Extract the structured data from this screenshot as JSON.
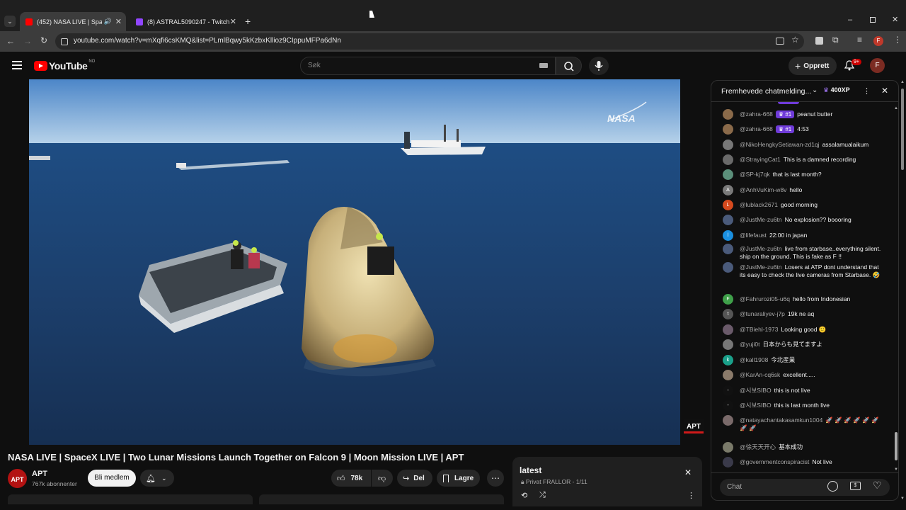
{
  "browser": {
    "tabs": [
      {
        "title": "(452) NASA LIVE | SpaceX LI",
        "active": true
      },
      {
        "title": "(8) ASTRAL5090247 - Twitch",
        "active": false
      }
    ],
    "url": "youtube.com/watch?v=mXqfi6csKMQ&list=PLmlBqwy5kKzbxKllioz9CIppuMFPa6dNn"
  },
  "youtube": {
    "logo_text": "YouTube",
    "region": "NO",
    "search_placeholder": "Søk",
    "create_label": "Opprett",
    "notif_count": "9+",
    "avatar_letter": "F"
  },
  "video": {
    "watermark": "NASA",
    "channel_bug": "APT"
  },
  "meta": {
    "title": "NASA LIVE | SpaceX LIVE | Two Lunar Missions Launch Together on Falcon 9 | Moon Mission LIVE | APT",
    "channel": "APT",
    "subscribers": "767k abonnenter",
    "join_label": "Bli medlem",
    "likes": "78k",
    "share_label": "Del",
    "save_label": "Lagre"
  },
  "playlist": {
    "title": "latest",
    "privacy": "Privat",
    "owner": "FRALLOR",
    "position": "1/11"
  },
  "chat": {
    "header": "Fremhevede chatmelding...",
    "xp_badge": "400XP",
    "input_placeholder": "Chat",
    "messages": [
      {
        "author": "@zahra-668",
        "badge": "#1",
        "text": "peanut butter",
        "avatar_color": "#8a6a4a",
        "initial": ""
      },
      {
        "author": "@zahra-668",
        "badge": "#1",
        "text": "4:53",
        "avatar_color": "#8a6a4a",
        "initial": ""
      },
      {
        "author": "@NikoHengkySetiawan-zd1qj",
        "badge": "",
        "text": "assalamualaikum",
        "avatar_color": "#777",
        "initial": ""
      },
      {
        "author": "@StrayingCat1",
        "badge": "",
        "text": "This is a damned recording",
        "avatar_color": "#6a6a6a",
        "initial": ""
      },
      {
        "author": "@SP-kj7qk",
        "badge": "",
        "text": "that is last month?",
        "avatar_color": "#5b8f7a",
        "initial": ""
      },
      {
        "author": "@AnhVuKim-w8v",
        "badge": "",
        "text": "hello",
        "avatar_color": "#7a7a7a",
        "initial": "A"
      },
      {
        "author": "@lublack2671",
        "badge": "",
        "text": "good morning",
        "avatar_color": "#d64a1e",
        "initial": "L"
      },
      {
        "author": "@JustMe-zu6tn",
        "badge": "",
        "text": "No explosion?? boooring",
        "avatar_color": "#4a5a7a",
        "initial": ""
      },
      {
        "author": "@lifefaust",
        "badge": "",
        "text": "22:00 in japan",
        "avatar_color": "#1a8fe0",
        "initial": "l"
      },
      {
        "author": "@JustMe-zu6tn",
        "badge": "",
        "text": "live from starbase..everything silent. ship on the ground. This is fake as F !!",
        "avatar_color": "#4a5a7a",
        "initial": ""
      },
      {
        "author": "@JustMe-zu6tn",
        "badge": "",
        "text": "Losers at ATP dont understand that its easy to check the live cameras from Starbase. 🤣",
        "avatar_color": "#4a5a7a",
        "initial": ""
      },
      {
        "author": "@Fahrurozi05-u6q",
        "badge": "",
        "text": "hello from Indonesian",
        "avatar_color": "#3fa04a",
        "initial": "F"
      },
      {
        "author": "@tunaraliyev-j7p",
        "badge": "",
        "text": "19k ne aq",
        "avatar_color": "#555",
        "initial": "t"
      },
      {
        "author": "@TBiehl-1973",
        "badge": "",
        "text": "Looking good 🙂",
        "avatar_color": "#6a5a6a",
        "initial": ""
      },
      {
        "author": "@yuji0t",
        "badge": "",
        "text": "日本からも見てますよ",
        "avatar_color": "#777",
        "initial": ""
      },
      {
        "author": "@kall1908",
        "badge": "",
        "text": "今北産業",
        "avatar_color": "#1aa08a",
        "initial": "k"
      },
      {
        "author": "@KarAn-cq6sk",
        "badge": "",
        "text": "excellent.....",
        "avatar_color": "#8a7a6a",
        "initial": ""
      },
      {
        "author": "@시보SIBO",
        "badge": "",
        "text": "this is not live",
        "avatar_color": "#111",
        "initial": "-"
      },
      {
        "author": "@시보SIBO",
        "badge": "",
        "text": "this is last month live",
        "avatar_color": "#111",
        "initial": "-"
      },
      {
        "author": "@natayachantakasamkun1004",
        "badge": "",
        "text": "🚀 🚀 🚀 🚀 🚀 🚀 🚀 🚀",
        "avatar_color": "#7a6a6a",
        "initial": ""
      },
      {
        "author": "@徐天天开心",
        "badge": "",
        "text": "基本成功",
        "avatar_color": "#7a7a6a",
        "initial": ""
      },
      {
        "author": "@governmentconspiracist",
        "badge": "",
        "text": "Not live",
        "avatar_color": "#3a3a4a",
        "initial": ""
      }
    ]
  },
  "colors": {
    "yt_red": "#ff0000",
    "bg": "#0f0f0f",
    "ocean": "#1f4a78"
  }
}
